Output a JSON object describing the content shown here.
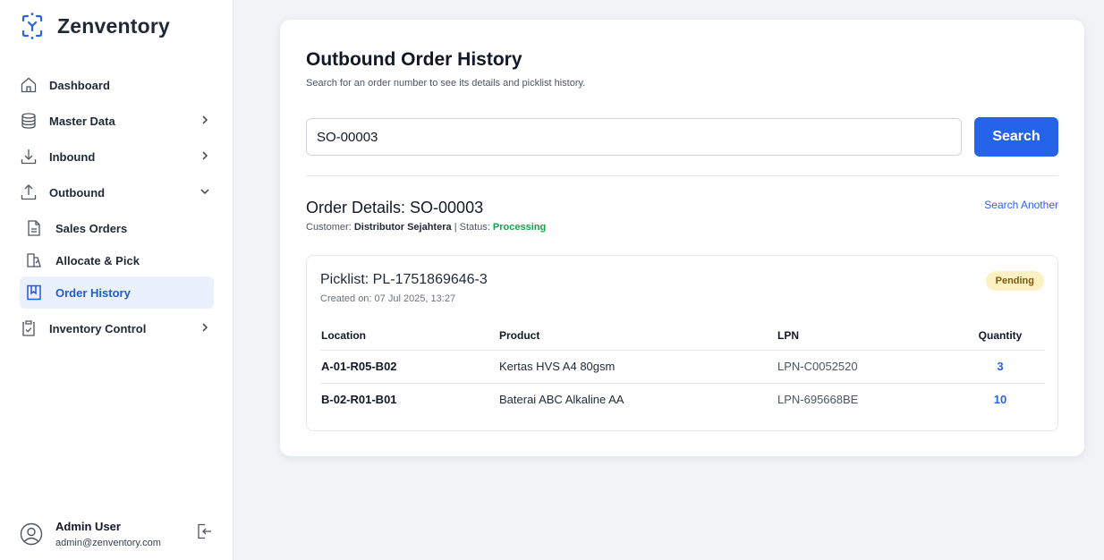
{
  "app": {
    "name": "Zenventory"
  },
  "sidebar": {
    "items": [
      {
        "label": "Dashboard",
        "icon": "home-icon"
      },
      {
        "label": "Master Data",
        "icon": "database-icon"
      },
      {
        "label": "Inbound",
        "icon": "download-icon"
      },
      {
        "label": "Outbound",
        "icon": "upload-icon"
      },
      {
        "label": "Sales Orders",
        "icon": "document-icon"
      },
      {
        "label": "Allocate & Pick",
        "icon": "pick-icon"
      },
      {
        "label": "Order History",
        "icon": "book-icon"
      },
      {
        "label": "Inventory Control",
        "icon": "clipboard-check-icon"
      }
    ],
    "active": "Order History"
  },
  "user": {
    "name": "Admin User",
    "email": "admin@zenventory.com"
  },
  "page": {
    "title": "Outbound Order History",
    "subtitle": "Search for an order number to see its details and picklist history."
  },
  "search": {
    "value": "SO-00003",
    "button_label": "Search"
  },
  "order": {
    "title": "Order Details: SO-00003",
    "customer_label": "Customer:",
    "customer": "Distributor Sejahtera",
    "separator": "|",
    "status_label": "Status:",
    "status": "Processing",
    "search_another": "Search Another"
  },
  "picklist": {
    "title": "Picklist: PL-1751869646-3",
    "created": "Created on: 07 Jul 2025, 13:27",
    "badge": "Pending",
    "columns": [
      "Location",
      "Product",
      "LPN",
      "Quantity"
    ],
    "rows": [
      {
        "location": "A-01-R05-B02",
        "product": "Kertas HVS A4 80gsm",
        "lpn": "LPN-C0052520",
        "quantity": "3"
      },
      {
        "location": "B-02-R01-B01",
        "product": "Baterai ABC Alkaline AA",
        "lpn": "LPN-695668BE",
        "quantity": "10"
      }
    ]
  },
  "colors": {
    "accent": "#2563eb",
    "active_bg": "#eaf1fd",
    "status_green": "#16a34a",
    "badge_bg": "#fdf1c3"
  }
}
